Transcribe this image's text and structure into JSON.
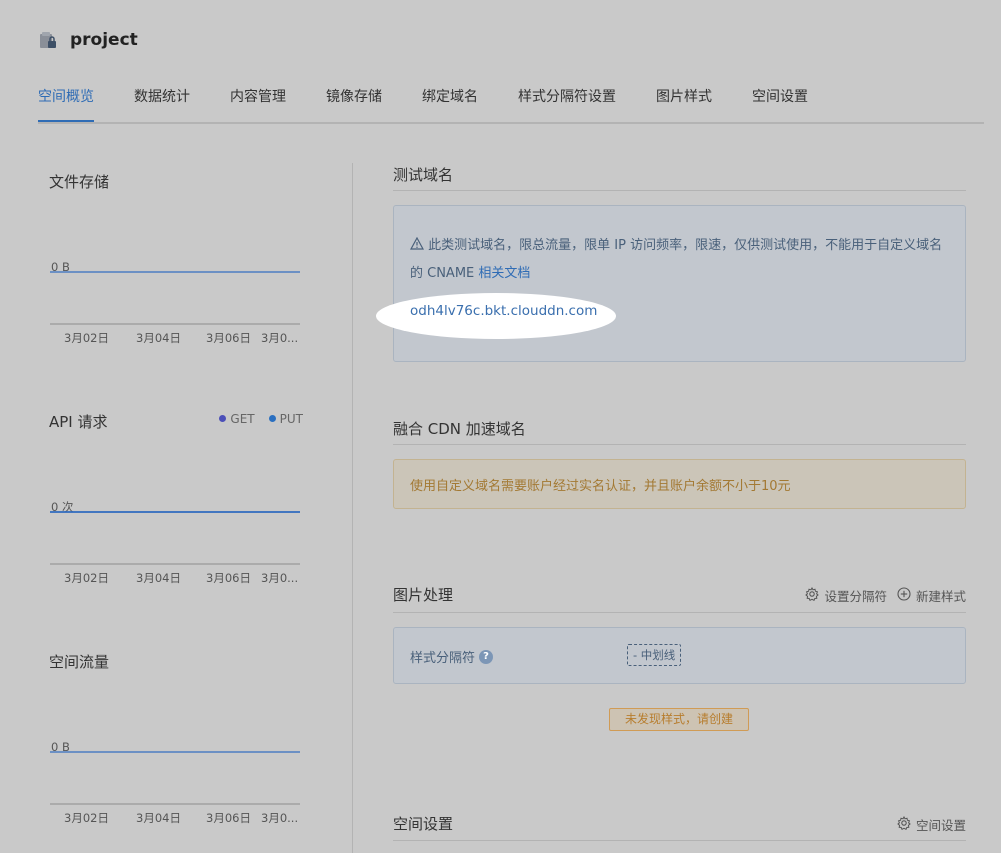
{
  "header": {
    "title": "project",
    "icon": "bucket-lock-icon"
  },
  "tabs": [
    {
      "label": "空间概览",
      "active": true
    },
    {
      "label": "数据统计",
      "active": false
    },
    {
      "label": "内容管理",
      "active": false
    },
    {
      "label": "镜像存储",
      "active": false
    },
    {
      "label": "绑定域名",
      "active": false
    },
    {
      "label": "样式分隔符设置",
      "active": false
    },
    {
      "label": "图片样式",
      "active": false
    },
    {
      "label": "空间设置",
      "active": false
    }
  ],
  "charts": {
    "storage": {
      "title": "文件存储"
    },
    "api": {
      "title": "API 请求",
      "legend": [
        {
          "name": "GET",
          "color": "#4b4fb8"
        },
        {
          "name": "PUT",
          "color": "#2a6fc0"
        }
      ]
    },
    "traffic": {
      "title": "空间流量"
    }
  },
  "chart_data": [
    {
      "type": "line",
      "title": "文件存储",
      "x": [
        "3月02日",
        "3月04日",
        "3月06日",
        "3月0..."
      ],
      "ytick_label": "0 B",
      "series": [
        {
          "values": [
            0,
            0,
            0,
            0
          ],
          "color": "#4e7ec2"
        }
      ]
    },
    {
      "type": "line",
      "title": "API 请求",
      "x": [
        "3月02日",
        "3月04日",
        "3月06日",
        "3月0..."
      ],
      "ytick_label": "0 次",
      "legend": [
        "GET",
        "PUT"
      ],
      "series": [
        {
          "name": "GET",
          "values": [
            0,
            0,
            0,
            0
          ],
          "color": "#4b4fb8"
        },
        {
          "name": "PUT",
          "values": [
            0,
            0,
            0,
            0
          ],
          "color": "#2a6fc0"
        }
      ]
    },
    {
      "type": "line",
      "title": "空间流量",
      "x": [
        "3月02日",
        "3月04日",
        "3月06日",
        "3月0..."
      ],
      "ytick_label": "0 B",
      "series": [
        {
          "values": [
            0,
            0,
            0,
            0
          ],
          "color": "#4e7ec2"
        }
      ]
    }
  ],
  "test_domain": {
    "title": "测试域名",
    "notice": "此类测试域名，限总流量，限单 IP 访问频率，限速，仅供测试使用，不能用于自定义域名的 CNAME",
    "doc_link": "相关文档",
    "domain": "odh4lv76c.bkt.clouddn.com"
  },
  "cdn": {
    "title": "融合 CDN 加速域名",
    "warning": "使用自定义域名需要账户经过实名认证，并且账户余额不小于10元"
  },
  "image_processing": {
    "title": "图片处理",
    "set_separator": "设置分隔符",
    "new_style": "新建样式",
    "separator_label": "样式分隔符",
    "separator_value": "- 中划线",
    "empty_notice": "未发现样式，请创建"
  },
  "space_settings": {
    "title": "空间设置",
    "action": "空间设置"
  },
  "colors": {
    "accent": "#2f6cb5",
    "warning": "#a37933"
  }
}
